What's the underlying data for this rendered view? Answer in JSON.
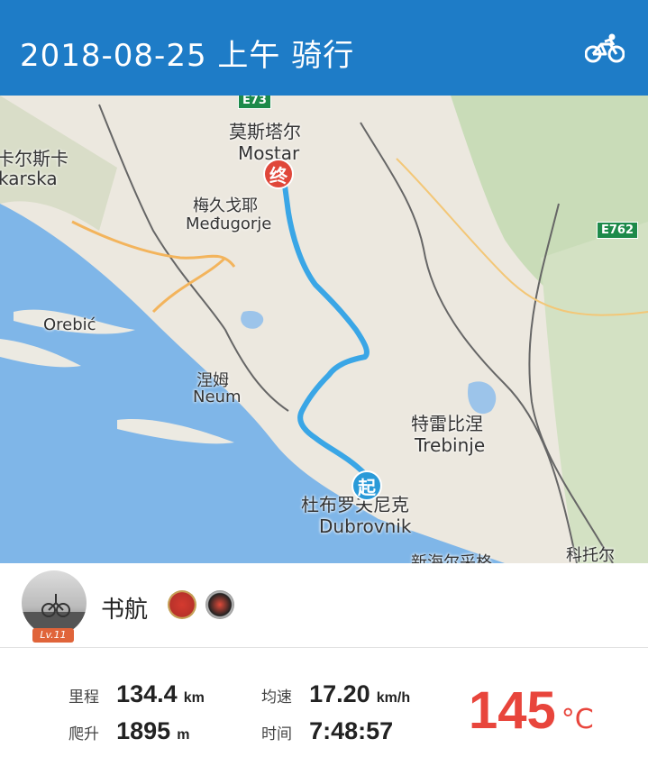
{
  "header": {
    "title": "2018-08-25 上午 骑行",
    "activity_icon": "bicycle-icon",
    "background_color": "#1E7CC7"
  },
  "map": {
    "labels": {
      "mostar_cn": "莫斯塔尔",
      "mostar": "Mostar",
      "makarska_cn": "卡尔斯卡",
      "makarska": "karska",
      "medjugorje_cn": "梅久戈耶",
      "medjugorje": "Međugorje",
      "orebic": "Orebić",
      "neum_cn": "涅姆",
      "neum": "Neum",
      "trebinje_cn": "特雷比涅",
      "trebinje": "Trebinje",
      "dubrovnik_cn": "杜布罗夫尼克",
      "dubrovnik": "Dubrovnik",
      "herceg_novi_cn": "新海尔采格",
      "kotor_cn": "科托尔",
      "road_e762": "E762",
      "road_e73": "E73"
    },
    "start_marker": "起",
    "end_marker": "终",
    "route_color": "#3AA6E6"
  },
  "user": {
    "name": "书航",
    "level": "Lv.11",
    "badges": [
      "flag-badge-icon",
      "medal-badge-icon"
    ]
  },
  "stats": {
    "distance": {
      "label": "里程",
      "value": "134.4",
      "unit": "km"
    },
    "climb": {
      "label": "爬升",
      "value": "1895",
      "unit": "m"
    },
    "avg_speed": {
      "label": "均速",
      "value": "17.20",
      "unit": "km/h"
    },
    "time": {
      "label": "时间",
      "value": "7:48:57",
      "unit": ""
    },
    "temperature": {
      "value": "145",
      "unit": "°C",
      "color": "#E8453C"
    }
  }
}
